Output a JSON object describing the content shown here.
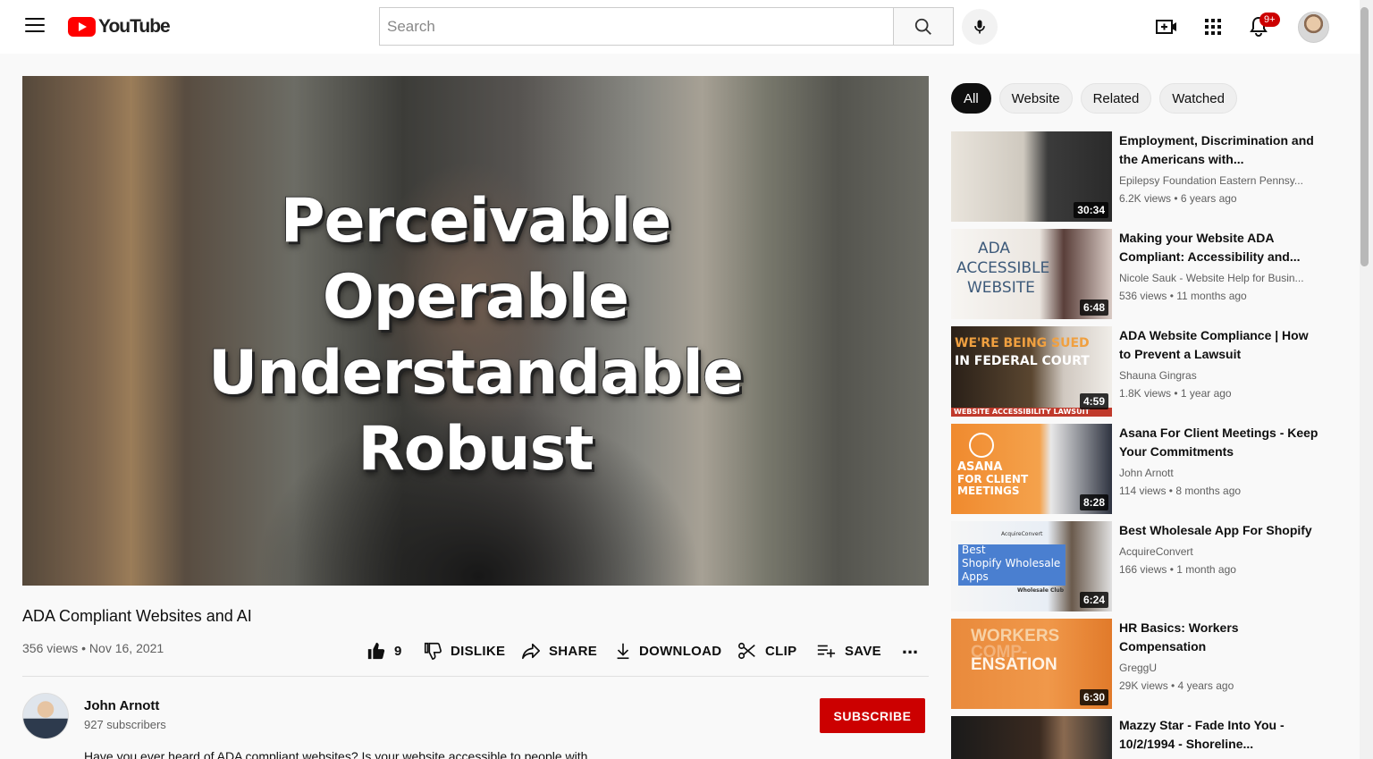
{
  "header": {
    "logo_text": "YouTube",
    "search_placeholder": "Search",
    "notification_badge": "9+"
  },
  "video": {
    "overlay_lines": [
      "Perceivable",
      "Operable",
      "Understandable",
      "Robust"
    ],
    "title": "ADA Compliant Websites and AI",
    "meta": "356 views • Nov 16, 2021",
    "actions": {
      "likes": "9",
      "dislike": "DISLIKE",
      "share": "SHARE",
      "download": "DOWNLOAD",
      "clip": "CLIP",
      "save": "SAVE",
      "more": "..."
    }
  },
  "channel": {
    "name": "John Arnott",
    "subscribers": "927 subscribers",
    "subscribe_label": "SUBSCRIBE",
    "description": "Have you ever heard of ADA compliant websites? Is your website accessible to people with"
  },
  "chips": [
    {
      "label": "All",
      "active": true
    },
    {
      "label": "Website",
      "active": false
    },
    {
      "label": "Related",
      "active": false
    },
    {
      "label": "Watched",
      "active": false
    }
  ],
  "related": [
    {
      "title": "Employment, Discrimination and the Americans with...",
      "channel": "Epilepsy Foundation Eastern Pennsy...",
      "stats": "6.2K views • 6 years ago",
      "duration": "30:34"
    },
    {
      "title": "Making your Website ADA Compliant: Accessibility and...",
      "channel": "Nicole Sauk - Website Help for Busin...",
      "stats": "536 views • 11 months ago",
      "duration": "6:48",
      "thumb_text": [
        "ADA",
        "ACCESSIBLE",
        "WEBSITE"
      ]
    },
    {
      "title": "ADA Website Compliance | How to Prevent a Lawsuit",
      "channel": "Shauna Gingras",
      "stats": "1.8K views • 1 year ago",
      "duration": "4:59",
      "thumb_text": [
        "WE'RE BEING SUED",
        "IN FEDERAL COURT",
        "WEBSITE ACCESSIBILITY LAWSUIT"
      ]
    },
    {
      "title": "Asana For Client Meetings - Keep Your Commitments",
      "channel": "John Arnott",
      "stats": "114 views • 8 months ago",
      "duration": "8:28",
      "thumb_text": [
        "ASANA",
        "FOR CLIENT",
        "MEETINGS"
      ]
    },
    {
      "title": "Best Wholesale App For Shopify",
      "channel": "AcquireConvert",
      "stats": "166 views • 1 month ago",
      "duration": "6:24",
      "thumb_text": [
        "AcquireConvert",
        "Best",
        "Shopify Wholesale",
        "Apps",
        "Wholesale Club"
      ]
    },
    {
      "title": "HR Basics: Workers Compensation",
      "channel": "GreggU",
      "stats": "29K views • 4 years ago",
      "duration": "6:30",
      "thumb_text": [
        "WORKERS",
        "COMP-",
        "ENSATION"
      ]
    },
    {
      "title": "Mazzy Star - Fade Into You - 10/2/1994 - Shoreline...",
      "channel": "",
      "stats": "",
      "duration": ""
    }
  ]
}
